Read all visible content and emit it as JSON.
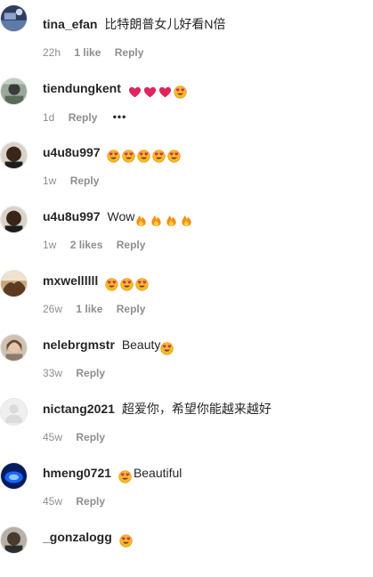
{
  "comments": [
    {
      "username": "tina_efan",
      "text": "比特朗普女儿好看N倍",
      "emojis": [],
      "emojis_after": [],
      "time": "22h",
      "likes": "1 like",
      "reply": "Reply",
      "avatar": "avatar-tina"
    },
    {
      "username": "tiendungkent",
      "text": "",
      "emojis": [
        "red-heart",
        "red-heart",
        "red-heart",
        "heart-eyes"
      ],
      "emojis_after": [],
      "time": "1d",
      "likes": "",
      "reply": "Reply",
      "more": "•••",
      "avatar": "avatar-tiendung"
    },
    {
      "username": "u4u8u997",
      "text": "",
      "emojis": [
        "heart-eyes",
        "heart-eyes",
        "heart-eyes",
        "heart-eyes",
        "heart-eyes"
      ],
      "emojis_after": [],
      "time": "1w",
      "likes": "",
      "reply": "Reply",
      "avatar": "avatar-u4u8"
    },
    {
      "username": "u4u8u997",
      "text": "Wow",
      "emojis": [],
      "emojis_after": [
        "fire",
        "fire",
        "fire",
        "fire"
      ],
      "time": "1w",
      "likes": "2 likes",
      "reply": "Reply",
      "avatar": "avatar-u4u8"
    },
    {
      "username": "mxwellllll",
      "text": "",
      "emojis": [
        "heart-eyes",
        "heart-eyes",
        "heart-eyes"
      ],
      "emojis_after": [],
      "time": "26w",
      "likes": "1 like",
      "reply": "Reply",
      "avatar": "avatar-mxwell"
    },
    {
      "username": "nelebrgmstr",
      "text": "Beauty",
      "emojis": [],
      "emojis_after": [
        "heart-eyes"
      ],
      "time": "33w",
      "likes": "",
      "reply": "Reply",
      "avatar": "avatar-nele"
    },
    {
      "username": "nictang2021",
      "text": "超爱你，希望你能越来越好",
      "emojis": [],
      "emojis_after": [],
      "time": "45w",
      "likes": "",
      "reply": "Reply",
      "avatar": "avatar-default"
    },
    {
      "username": "hmeng0721",
      "text": "Beautiful",
      "emojis": [
        "heart-eyes"
      ],
      "emojis_after": [],
      "time": "45w",
      "likes": "",
      "reply": "Reply",
      "avatar": "avatar-hmeng"
    },
    {
      "username": "_gonzalogg",
      "text": "",
      "emojis": [
        "heart-eyes"
      ],
      "emojis_after": [],
      "time": "",
      "likes": "",
      "reply": "",
      "avatar": "avatar-gonzalo"
    }
  ],
  "colors": {
    "text": "#262626",
    "meta": "#8e8e8e",
    "heart": "#e0245e",
    "emoji_face": "#f7b928",
    "fire": "#f4900c"
  }
}
